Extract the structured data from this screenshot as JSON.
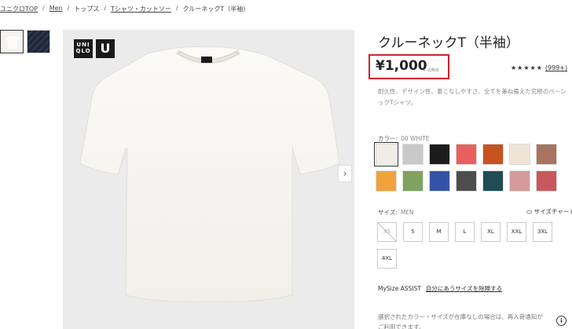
{
  "breadcrumb": {
    "items": [
      "ユニクロTOP",
      "Men",
      "トップス",
      "Tシャツ・カットソー",
      "クルーネックT（半袖）"
    ],
    "separator": "/"
  },
  "gallery": {
    "thumbnails": [
      "white-tshirt-thumbnail",
      "navy-fabric-thumbnail"
    ],
    "logo_text": "UNI QLO",
    "logo_u": "U",
    "next_arrow": "›"
  },
  "product": {
    "title": "クルーネックT（半袖）",
    "price": "¥1,000",
    "tax_note": "+ 消費税",
    "rating_stars": "★★★★★",
    "rating_count": "(999+)",
    "description_line1": "耐久性、デザイン性、着こなしやすさ、全てを兼ね備えた究極のベーシ",
    "description_line2": "ックTシャツ。"
  },
  "colors": {
    "label": "カラー:",
    "selected_value": "00 WHITE",
    "swatches": [
      "#f0ede6",
      "#c9c9c9",
      "#1c1c1c",
      "#e8605e",
      "#c7521e",
      "#efe4d6",
      "#a87460",
      "#f0a33c",
      "#7fa261",
      "#3553a6",
      "#4d4d4d",
      "#1f4c55",
      "#d69a9c",
      "#c9585c"
    ]
  },
  "sizes": {
    "label": "サイズ:",
    "selected_value": "MEN",
    "chart_label": "サイズチャート",
    "options": [
      "XS",
      "S",
      "M",
      "L",
      "XL",
      "XXL",
      "3XL",
      "4XL"
    ]
  },
  "mysize": {
    "label": "MySize ASSIST",
    "link": "自分にあうサイズを除険する"
  },
  "notice": {
    "line1": "選択されたカラー・サイズが在庫なしの場合は、再入荷通知が",
    "line2": "ご利用できます。"
  },
  "info_button": "i"
}
